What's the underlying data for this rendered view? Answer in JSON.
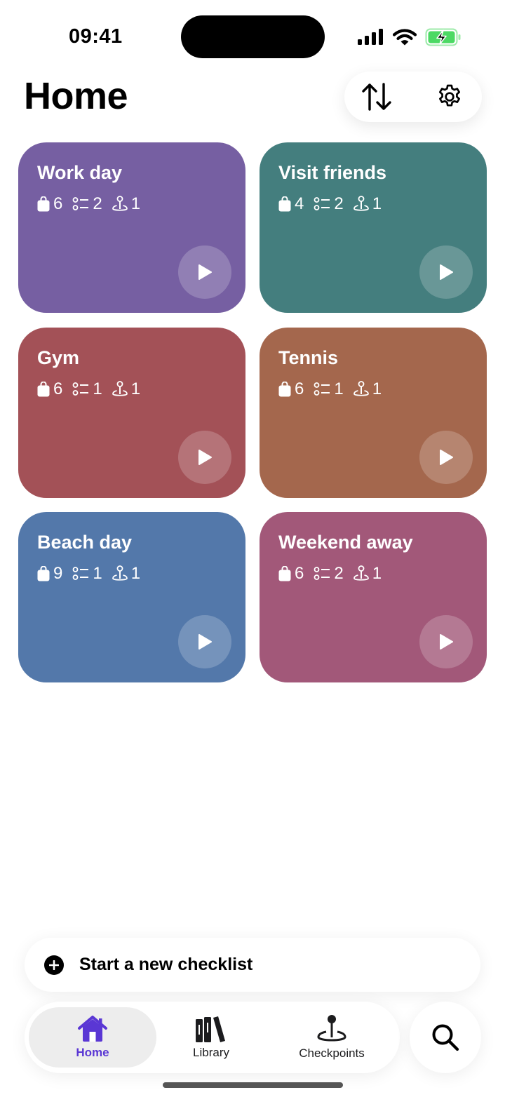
{
  "status_bar": {
    "time": "09:41"
  },
  "header": {
    "title": "Home"
  },
  "cards": [
    {
      "title": "Work day",
      "color": "#765fa2",
      "items": "6",
      "lists": "2",
      "checkpoints": "1"
    },
    {
      "title": "Visit friends",
      "color": "#447e7e",
      "items": "4",
      "lists": "2",
      "checkpoints": "1"
    },
    {
      "title": "Gym",
      "color": "#a35157",
      "items": "6",
      "lists": "1",
      "checkpoints": "1"
    },
    {
      "title": "Tennis",
      "color": "#a4674d",
      "items": "6",
      "lists": "1",
      "checkpoints": "1"
    },
    {
      "title": "Beach day",
      "color": "#5378aa",
      "items": "9",
      "lists": "1",
      "checkpoints": "1"
    },
    {
      "title": "Weekend away",
      "color": "#a25879",
      "items": "6",
      "lists": "2",
      "checkpoints": "1"
    }
  ],
  "new_checklist": {
    "label": "Start a new checklist"
  },
  "tabbar": {
    "tabs": [
      {
        "label": "Home",
        "active": true
      },
      {
        "label": "Library",
        "active": false
      },
      {
        "label": "Checkpoints",
        "active": false
      }
    ]
  },
  "colors": {
    "accent": "#5a37d4",
    "battery": "#4cd964"
  }
}
